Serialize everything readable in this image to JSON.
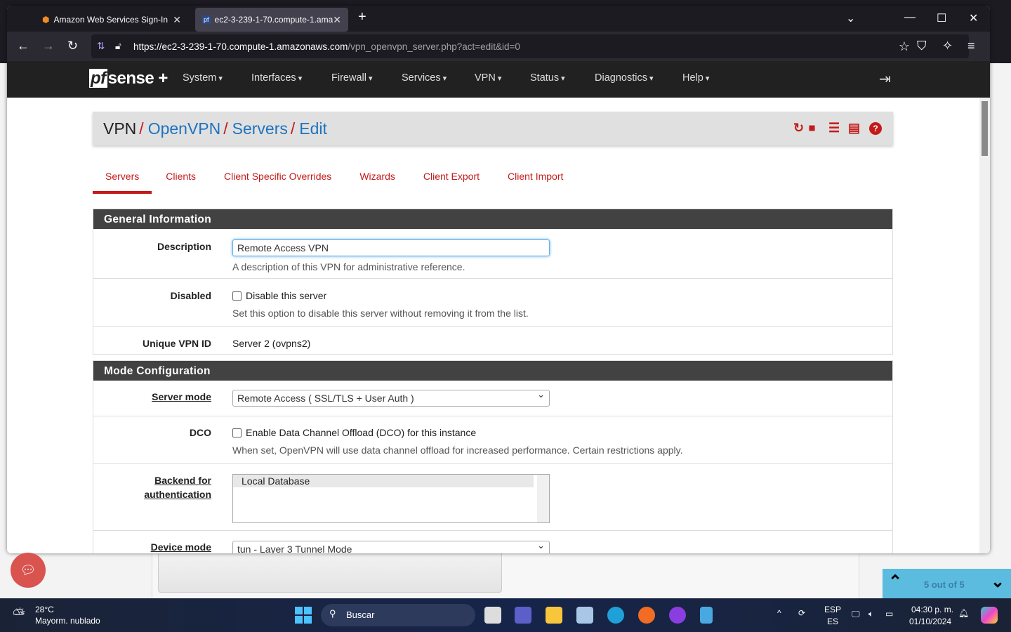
{
  "browser": {
    "tabs": [
      {
        "title": "Amazon Web Services Sign-In",
        "active": false
      },
      {
        "title": "ec2-3-239-1-70.compute-1.ama",
        "active": true
      }
    ],
    "url_host": "https://ec2-3-239-1-70.compute-1.amazonaws.com",
    "url_path": "/vpn_openvpn_server.php?act=edit&id=0"
  },
  "nav": {
    "logo": "pfsense+",
    "items": [
      "System",
      "Interfaces",
      "Firewall",
      "Services",
      "VPN",
      "Status",
      "Diagnostics",
      "Help"
    ]
  },
  "breadcrumb": {
    "root": "VPN",
    "links": [
      "OpenVPN",
      "Servers",
      "Edit"
    ]
  },
  "tabs": [
    {
      "label": "Servers",
      "active": true
    },
    {
      "label": "Clients"
    },
    {
      "label": "Client Specific Overrides"
    },
    {
      "label": "Wizards"
    },
    {
      "label": "Client Export"
    },
    {
      "label": "Client Import"
    }
  ],
  "general": {
    "title": "General Information",
    "description_label": "Description",
    "description_value": "Remote Access VPN",
    "description_help": "A description of this VPN for administrative reference.",
    "disabled_label": "Disabled",
    "disabled_checkbox": "Disable this server",
    "disabled_checked": false,
    "disabled_help": "Set this option to disable this server without removing it from the list.",
    "vpnid_label": "Unique VPN ID",
    "vpnid_value": "Server 2 (ovpns2)"
  },
  "mode": {
    "title": "Mode Configuration",
    "server_mode_label": "Server mode",
    "server_mode_value": "Remote Access ( SSL/TLS + User Auth )",
    "dco_label": "DCO",
    "dco_checkbox": "Enable Data Channel Offload (DCO) for this instance",
    "dco_checked": false,
    "dco_help": "When set, OpenVPN will use data channel offload for increased performance. Certain restrictions apply.",
    "backend_label_1": "Backend for",
    "backend_label_2": "authentication",
    "backend_option": "Local Database",
    "device_mode_label": "Device mode",
    "device_mode_value": "tun - Layer 3 Tunnel Mode"
  },
  "findbar": {
    "text": "5 out of 5"
  },
  "taskbar": {
    "weather_temp": "28°C",
    "weather_desc": "Mayorm. nublado",
    "search": "Buscar",
    "lang1": "ESP",
    "lang2": "ES",
    "time": "04:30 p. m.",
    "date": "01/10/2024"
  }
}
